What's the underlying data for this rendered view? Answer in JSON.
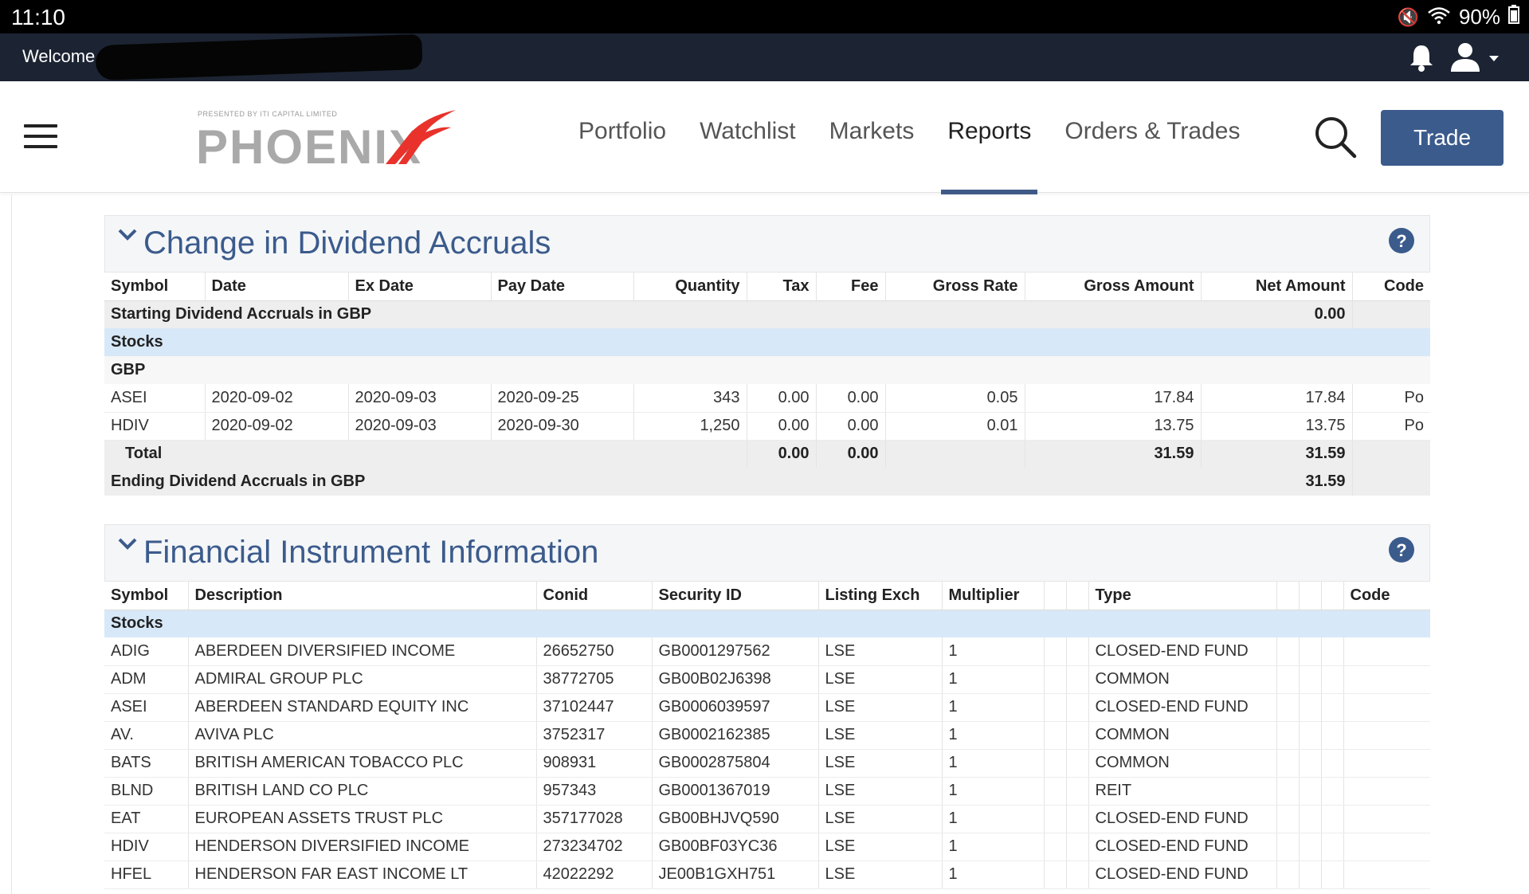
{
  "status_bar": {
    "time": "11:10",
    "battery": "90%"
  },
  "welcome_bar": {
    "welcome_text": "Welcome"
  },
  "navbar": {
    "logo_presented": "PRESENTED BY ITI CAPITAL LIMITED",
    "logo_text": "PHOENIX",
    "items": [
      {
        "label": "Portfolio"
      },
      {
        "label": "Watchlist"
      },
      {
        "label": "Markets"
      },
      {
        "label": "Reports"
      },
      {
        "label": "Orders & Trades"
      }
    ],
    "active_item": "Reports",
    "trade_label": "Trade"
  },
  "dividend": {
    "title": "Change in Dividend Accruals",
    "headers": [
      "Symbol",
      "Date",
      "Ex Date",
      "Pay Date",
      "Quantity",
      "Tax",
      "Fee",
      "Gross Rate",
      "Gross Amount",
      "Net Amount",
      "Code"
    ],
    "starting": {
      "label": "Starting Dividend Accruals in GBP",
      "value": "0.00"
    },
    "group": "Stocks",
    "currency": "GBP",
    "rows": [
      {
        "symbol": "ASEI",
        "date": "2020-09-02",
        "ex_date": "2020-09-03",
        "pay_date": "2020-09-25",
        "quantity": "343",
        "tax": "0.00",
        "fee": "0.00",
        "gross_rate": "0.05",
        "gross_amount": "17.84",
        "net_amount": "17.84",
        "code": "Po"
      },
      {
        "symbol": "HDIV",
        "date": "2020-09-02",
        "ex_date": "2020-09-03",
        "pay_date": "2020-09-30",
        "quantity": "1,250",
        "tax": "0.00",
        "fee": "0.00",
        "gross_rate": "0.01",
        "gross_amount": "13.75",
        "net_amount": "13.75",
        "code": "Po"
      }
    ],
    "total": {
      "label": "Total",
      "tax": "0.00",
      "fee": "0.00",
      "gross_amount": "31.59",
      "net_amount": "31.59"
    },
    "ending": {
      "label": "Ending Dividend Accruals in GBP",
      "value": "31.59"
    }
  },
  "instruments": {
    "title": "Financial Instrument Information",
    "headers": [
      "Symbol",
      "Description",
      "Conid",
      "Security ID",
      "Listing Exch",
      "Multiplier",
      "",
      "",
      "Type",
      "",
      "",
      "",
      "Code"
    ],
    "group": "Stocks",
    "rows": [
      {
        "symbol": "ADIG",
        "description": "ABERDEEN DIVERSIFIED INCOME",
        "conid": "26652750",
        "security_id": "GB0001297562",
        "exch": "LSE",
        "multiplier": "1",
        "type": "CLOSED-END FUND"
      },
      {
        "symbol": "ADM",
        "description": "ADMIRAL GROUP PLC",
        "conid": "38772705",
        "security_id": "GB00B02J6398",
        "exch": "LSE",
        "multiplier": "1",
        "type": "COMMON"
      },
      {
        "symbol": "ASEI",
        "description": "ABERDEEN STANDARD EQUITY INC",
        "conid": "37102447",
        "security_id": "GB0006039597",
        "exch": "LSE",
        "multiplier": "1",
        "type": "CLOSED-END FUND"
      },
      {
        "symbol": "AV.",
        "description": "AVIVA PLC",
        "conid": "3752317",
        "security_id": "GB0002162385",
        "exch": "LSE",
        "multiplier": "1",
        "type": "COMMON"
      },
      {
        "symbol": "BATS",
        "description": "BRITISH AMERICAN TOBACCO PLC",
        "conid": "908931",
        "security_id": "GB0002875804",
        "exch": "LSE",
        "multiplier": "1",
        "type": "COMMON"
      },
      {
        "symbol": "BLND",
        "description": "BRITISH LAND CO PLC",
        "conid": "957343",
        "security_id": "GB0001367019",
        "exch": "LSE",
        "multiplier": "1",
        "type": "REIT"
      },
      {
        "symbol": "EAT",
        "description": "EUROPEAN ASSETS TRUST PLC",
        "conid": "357177028",
        "security_id": "GB00BHJVQ590",
        "exch": "LSE",
        "multiplier": "1",
        "type": "CLOSED-END FUND"
      },
      {
        "symbol": "HDIV",
        "description": "HENDERSON DIVERSIFIED INCOME",
        "conid": "273234702",
        "security_id": "GB00BF03YC36",
        "exch": "LSE",
        "multiplier": "1",
        "type": "CLOSED-END FUND"
      },
      {
        "symbol": "HFEL",
        "description": "HENDERSON FAR EAST INCOME LT",
        "conid": "42022292",
        "security_id": "JE00B1GXH751",
        "exch": "LSE",
        "multiplier": "1",
        "type": "CLOSED-END FUND"
      }
    ]
  }
}
